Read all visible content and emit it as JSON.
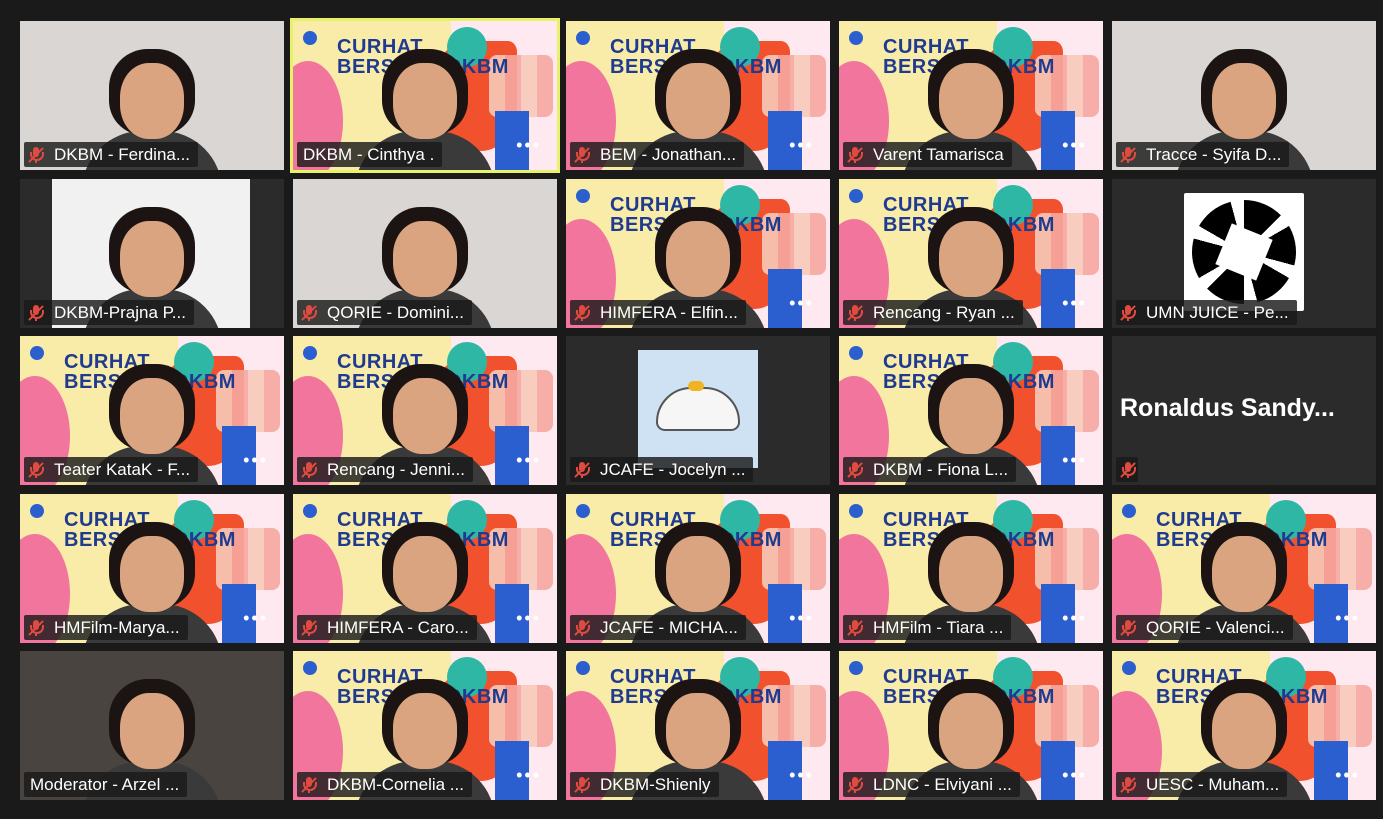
{
  "meeting": {
    "participants": [
      {
        "name": "DKBM - Ferdina...",
        "muted": true,
        "bg": "plain",
        "active": false
      },
      {
        "name": "DKBM - Cinthya .",
        "muted": false,
        "bg": "vbg",
        "active": true
      },
      {
        "name": "BEM - Jonathan...",
        "muted": true,
        "bg": "vbg",
        "active": false
      },
      {
        "name": "Varent Tamarisca",
        "muted": true,
        "bg": "vbg",
        "active": false
      },
      {
        "name": "Tracce - Syifa D...",
        "muted": true,
        "bg": "plain",
        "active": false
      },
      {
        "name": "DKBM-Prajna P...",
        "muted": true,
        "bg": "portrait",
        "active": false
      },
      {
        "name": "QORIE - Domini...",
        "muted": true,
        "bg": "plain",
        "active": false
      },
      {
        "name": "HIMFERA - Elfin...",
        "muted": true,
        "bg": "vbg",
        "active": false
      },
      {
        "name": "Rencang - Ryan ...",
        "muted": true,
        "bg": "vbg",
        "active": false
      },
      {
        "name": "UMN JUICE - Pe...",
        "muted": true,
        "bg": "aperture",
        "active": false
      },
      {
        "name": "Teater KataK - F...",
        "muted": true,
        "bg": "vbg",
        "active": false
      },
      {
        "name": "Rencang - Jenni...",
        "muted": true,
        "bg": "vbg",
        "active": false
      },
      {
        "name": "JCAFE - Jocelyn ...",
        "muted": true,
        "bg": "avatar",
        "active": false
      },
      {
        "name": "DKBM - Fiona L...",
        "muted": true,
        "bg": "vbg",
        "active": false
      },
      {
        "name": "",
        "muted": true,
        "bg": "nameonly",
        "bigname": "Ronaldus  Sandy...",
        "active": false
      },
      {
        "name": "HMFilm-Marya...",
        "muted": true,
        "bg": "vbg",
        "active": false
      },
      {
        "name": "HIMFERA - Caro...",
        "muted": true,
        "bg": "vbg",
        "active": false
      },
      {
        "name": "JCAFE - MICHA...",
        "muted": true,
        "bg": "vbg",
        "active": false
      },
      {
        "name": "HMFilm - Tiara ...",
        "muted": true,
        "bg": "vbg",
        "active": false
      },
      {
        "name": "QORIE - Valenci...",
        "muted": true,
        "bg": "vbg",
        "active": false
      },
      {
        "name": "Moderator - Arzel ...",
        "muted": false,
        "bg": "plaindark",
        "active": false
      },
      {
        "name": "DKBM-Cornelia ...",
        "muted": true,
        "bg": "vbg",
        "active": false
      },
      {
        "name": "DKBM-Shienly",
        "muted": true,
        "bg": "vbg",
        "active": false
      },
      {
        "name": "LDNC - Elviyani ...",
        "muted": true,
        "bg": "vbg",
        "active": false
      },
      {
        "name": "UESC - Muham...",
        "muted": true,
        "bg": "vbg",
        "active": false
      }
    ]
  },
  "background": {
    "title_line1": "CURHAT",
    "title_line2": "BERSAMA DKBM",
    "dots": "•••"
  },
  "colors": {
    "active_outline": "#e9f06a",
    "mute_icon": "#e04a3f",
    "tile_bg": "#2b2b2b"
  }
}
